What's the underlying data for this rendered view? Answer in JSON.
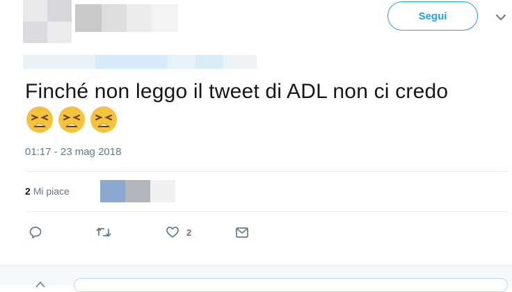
{
  "header": {
    "follow_label": "Segui",
    "chevron_icon": "chevron-down-icon"
  },
  "tweet": {
    "text": "Finché non leggo il tweet di ADL non ci credo",
    "emojis": [
      "weary-face-icon",
      "weary-face-icon",
      "weary-face-icon"
    ],
    "timestamp": "01:17 - 23 mag 2018"
  },
  "stats": {
    "likes_count": "2",
    "likes_label": "Mi piace"
  },
  "actions": {
    "reply_icon": "reply-icon",
    "retweet_icon": "retweet-icon",
    "like_icon": "heart-icon",
    "like_count": "2",
    "dm_icon": "envelope-icon"
  },
  "colors": {
    "accent": "#1da1f2",
    "text": "#14171a",
    "muted": "#657786",
    "divider": "#e6ecf0"
  }
}
